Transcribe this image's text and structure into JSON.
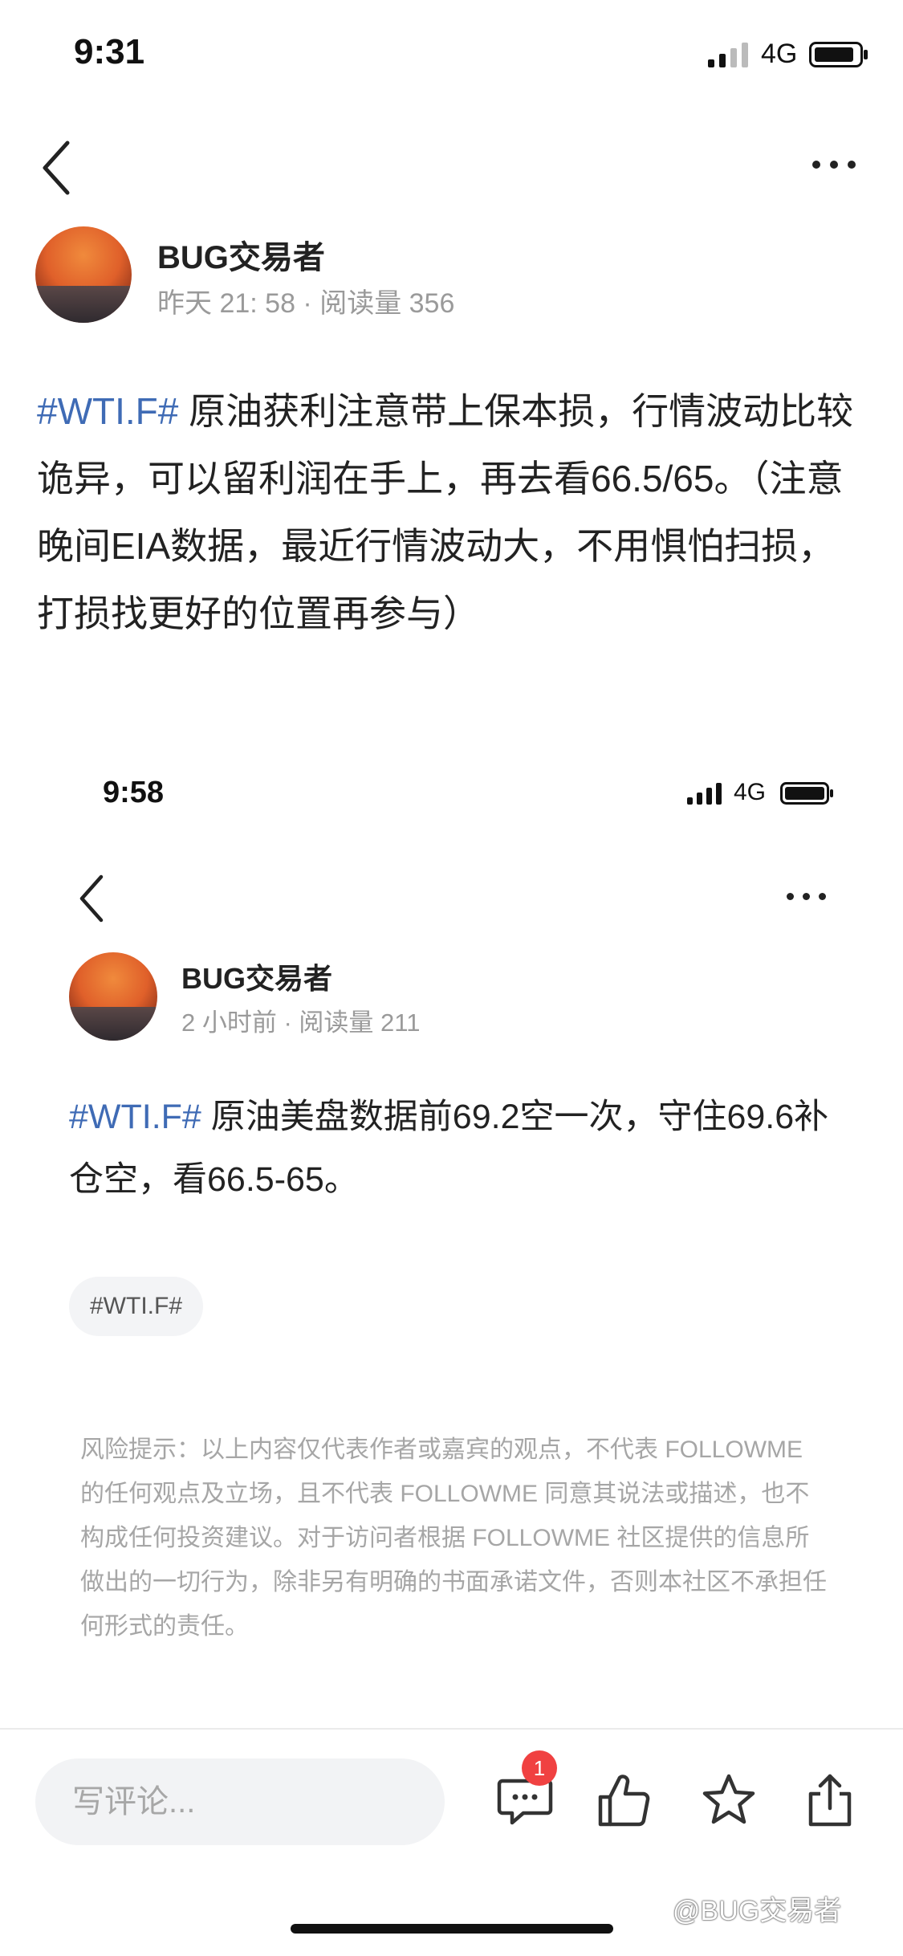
{
  "screen1": {
    "status": {
      "time": "9:31",
      "network": "4G"
    },
    "author": {
      "name": "BUG交易者",
      "meta": "昨天 21: 58 · 阅读量 356"
    },
    "post": {
      "tag": "#WTI.F#",
      "text": " 原油获利注意带上保本损，行情波动比较诡异，可以留利润在手上，再去看66.5/65。（注意晚间EIA数据，最近行情波动大，不用惧怕扫损，打损找更好的位置再参与）"
    }
  },
  "screen2": {
    "status": {
      "time": "9:58",
      "network": "4G"
    },
    "author": {
      "name": "BUG交易者",
      "meta": "2 小时前 · 阅读量 211"
    },
    "post": {
      "tag": "#WTI.F#",
      "text": " 原油美盘数据前69.2空一次，守住69.6补仓空，看66.5-65。"
    },
    "topic_chip": "#WTI.F#",
    "disclaimer": "风险提示：以上内容仅代表作者或嘉宾的观点，不代表 FOLLOWME 的任何观点及立场，且不代表 FOLLOWME 同意其说法或描述，也不构成任何投资建议。对于访问者根据 FOLLOWME 社区提供的信息所做出的一切行为，除非另有明确的书面承诺文件，否则本社区不承担任何形式的责任。",
    "bottom_bar": {
      "comment_placeholder": "写评论...",
      "comment_badge": "1"
    }
  },
  "watermark": "@BUG交易者",
  "icons": [
    "signal-icon",
    "battery-icon",
    "back-icon",
    "more-icon",
    "comment-icon",
    "like-icon",
    "star-icon",
    "share-icon"
  ],
  "colors": {
    "tag": "#3f6bb5",
    "badge": "#f04141",
    "meta": "#9a9a9a"
  }
}
